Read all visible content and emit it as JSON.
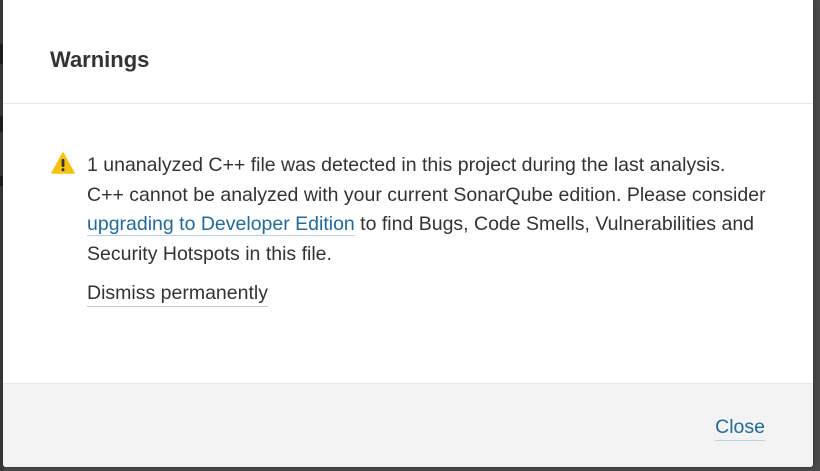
{
  "modal": {
    "title": "Warnings",
    "warning": {
      "icon": "warning-triangle-icon",
      "text_before_link": "1 unanalyzed C++ file was detected in this project during the last analysis. C++ cannot be analyzed with your current SonarQube edition. Please consider ",
      "link_label": "upgrading to Developer Edition",
      "text_after_link": " to find Bugs, Code Smells, Vulnerabilities and Security Hotspots in this file."
    },
    "dismiss_label": "Dismiss permanently",
    "close_label": "Close"
  },
  "colors": {
    "warning_icon": "#f4c20d",
    "link": "#236a97",
    "text": "#333333",
    "footer_background": "#f3f3f3"
  }
}
